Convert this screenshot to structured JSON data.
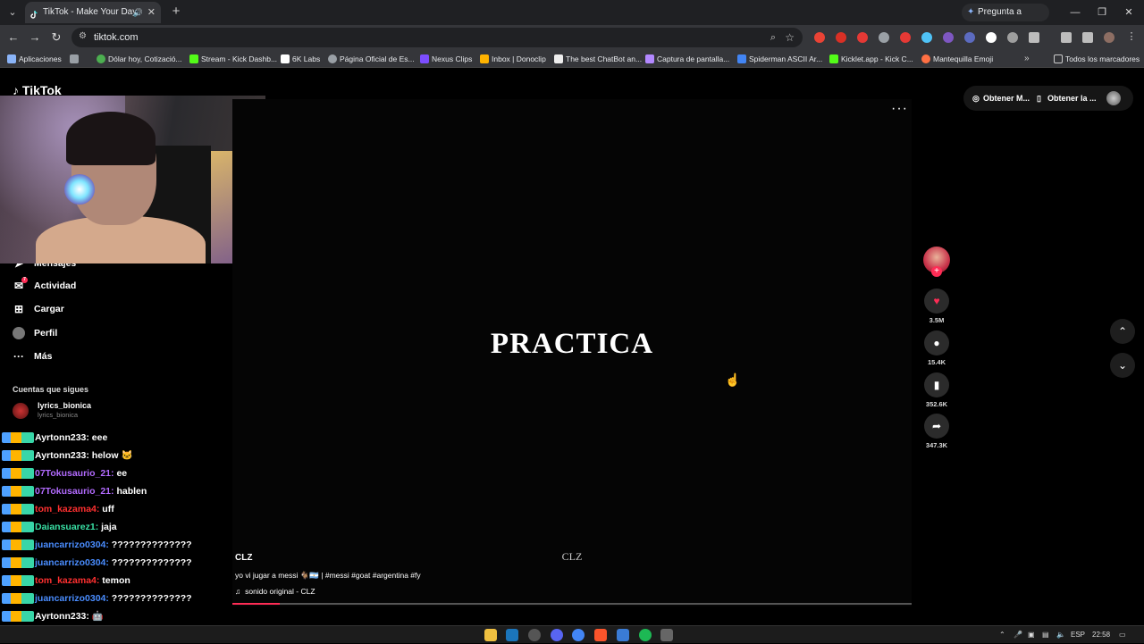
{
  "browser": {
    "tab_title": "TikTok - Make Your Day",
    "tab_list_icon": "chevron-down-icon",
    "new_tab_label": "+",
    "gemini_label": "Pregunta a Gemini",
    "url": "tiktok.com",
    "bookmarks": [
      {
        "label": "Aplicaciones",
        "color": "#8ab4f8"
      },
      {
        "label": "Dólar hoy, Cotizació...",
        "color": "#4caf50"
      },
      {
        "label": "Stream - Kick Dashb...",
        "color": "#53fc18"
      },
      {
        "label": "6K Labs",
        "color": "#ffffff"
      },
      {
        "label": "Página Oficial de Es...",
        "color": "#9aa0a6"
      },
      {
        "label": "Nexus Clips",
        "color": "#7c4dff"
      },
      {
        "label": "Inbox | Donoclip",
        "color": "#ffb300"
      },
      {
        "label": "The best ChatBot an...",
        "color": "#eeeeee"
      },
      {
        "label": "Captura de pantalla...",
        "color": "#b388ff"
      },
      {
        "label": "Spiderman ASCII Ar...",
        "color": "#4285f4"
      },
      {
        "label": "Kicklet.app - Kick C...",
        "color": "#53fc18"
      },
      {
        "label": "Mantequilla Emoji",
        "color": "#ff7043"
      }
    ],
    "bookmarks_more": "»",
    "all_bookmarks": "Todos los marcadores"
  },
  "tiktok": {
    "logo": "TikTok",
    "sidebar": [
      {
        "label": "Mensajes",
        "icon": "send-icon"
      },
      {
        "label": "Actividad",
        "icon": "inbox-icon",
        "badge": "7"
      },
      {
        "label": "Cargar",
        "icon": "upload-icon"
      },
      {
        "label": "Perfil",
        "icon": "profile-icon"
      },
      {
        "label": "Más",
        "icon": "more-icon"
      }
    ],
    "following_title": "Cuentas que sigues",
    "following": [
      {
        "name": "lyrics_bionica",
        "handle": "lyrics_bionica"
      }
    ],
    "top_actions": {
      "get_coins": "Obtener M...",
      "get_app": "Obtener la ..."
    },
    "video": {
      "overlay_text": "PRACTICA",
      "watermark": "CLZ",
      "author": "CLZ",
      "description": "yo vi jugar a messi 🐐🇦🇷 | #messi #goat #argentina #fy",
      "music": "sonido original - CLZ",
      "progress": 0.07
    },
    "actions": [
      {
        "name": "like",
        "icon": "heart-icon",
        "count": "3.5M",
        "color": "#fe2c55"
      },
      {
        "name": "comment",
        "icon": "comment-icon",
        "count": "15.4K",
        "color": "#ffffff"
      },
      {
        "name": "save",
        "icon": "bookmark-icon",
        "count": "352.6K",
        "color": "#ffffff"
      },
      {
        "name": "share",
        "icon": "share-icon",
        "count": "347.3K",
        "color": "#ffffff"
      }
    ]
  },
  "chat": [
    {
      "user": "Ayrtonn233:",
      "msg": "eee",
      "color": "#ffffff"
    },
    {
      "user": "Ayrtonn233:",
      "msg": "helow 🐱",
      "color": "#ffffff"
    },
    {
      "user": "07Tokusaurio_21:",
      "msg": "ee",
      "color": "#b36bff"
    },
    {
      "user": "07Tokusaurio_21:",
      "msg": "hablen",
      "color": "#b36bff"
    },
    {
      "user": "tom_kazama4:",
      "msg": "uff",
      "color": "#ff3030"
    },
    {
      "user": "Daiansuarez1:",
      "msg": "jaja",
      "color": "#39e0a5"
    },
    {
      "user": "juancarrizo0304:",
      "msg": "??????????????",
      "color": "#4a8dff"
    },
    {
      "user": "juancarrizo0304:",
      "msg": "??????????????",
      "color": "#4a8dff"
    },
    {
      "user": "tom_kazama4:",
      "msg": "temon",
      "color": "#ff3030"
    },
    {
      "user": "juancarrizo0304:",
      "msg": "??????????????",
      "color": "#4a8dff"
    },
    {
      "user": "Ayrtonn233:",
      "msg": "🤖",
      "color": "#ffffff"
    },
    {
      "user": "juancarrizo0304:",
      "msg": "??????????????",
      "color": "#4a8dff"
    }
  ],
  "taskbar": {
    "lang": "ESP",
    "time": "22:58"
  }
}
